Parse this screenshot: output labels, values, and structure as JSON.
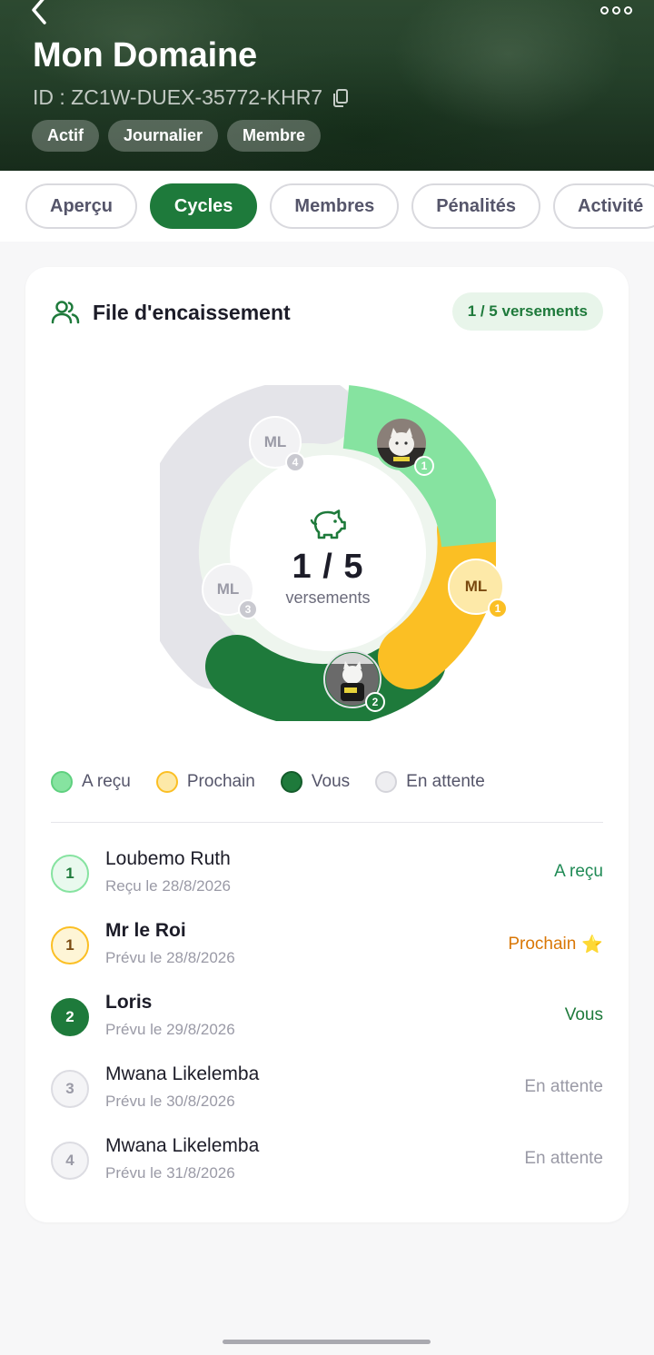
{
  "header": {
    "title": "Mon Domaine",
    "id_text": "ID : ZC1W-DUEX-35772-KHR7",
    "tags": [
      "Actif",
      "Journalier",
      "Membre"
    ],
    "icons": {
      "back": "chevron-left-icon",
      "more": "more-horizontal-icon",
      "copy": "copy-icon"
    }
  },
  "tabs": [
    {
      "label": "Aperçu",
      "active": false
    },
    {
      "label": "Cycles",
      "active": true
    },
    {
      "label": "Membres",
      "active": false
    },
    {
      "label": "Pénalités",
      "active": false
    },
    {
      "label": "Activité",
      "active": false
    }
  ],
  "queue": {
    "title": "File d'encaissement",
    "count_pill": "1 / 5 versements",
    "center": {
      "value": "1 / 5",
      "label": "versements",
      "icon": "piggy-bank-icon"
    },
    "donut_nodes": [
      {
        "initials": "",
        "badge": "1",
        "status": "received",
        "avatar": "cat-photo"
      },
      {
        "initials": "ML",
        "badge": "1",
        "status": "next"
      },
      {
        "initials": "",
        "badge": "2",
        "status": "you",
        "avatar": "cat-photo"
      },
      {
        "initials": "ML",
        "badge": "3",
        "status": "waiting"
      },
      {
        "initials": "ML",
        "badge": "4",
        "status": "waiting"
      }
    ],
    "legend": [
      {
        "label": "A reçu",
        "status": "received"
      },
      {
        "label": "Prochain",
        "status": "next"
      },
      {
        "label": "Vous",
        "status": "you"
      },
      {
        "label": "En attente",
        "status": "waiting"
      }
    ],
    "members": [
      {
        "rank": "1",
        "name": "Loubemo Ruth",
        "date": "Reçu le 28/8/2026",
        "status_label": "A reçu",
        "status": "received",
        "bold": false,
        "star": ""
      },
      {
        "rank": "1",
        "name": "Mr le Roi",
        "date": "Prévu le 28/8/2026",
        "status_label": "Prochain",
        "status": "next",
        "bold": true,
        "star": "⭐"
      },
      {
        "rank": "2",
        "name": "Loris",
        "date": "Prévu le 29/8/2026",
        "status_label": "Vous",
        "status": "you",
        "bold": true,
        "star": ""
      },
      {
        "rank": "3",
        "name": "Mwana Likelemba",
        "date": "Prévu le 30/8/2026",
        "status_label": "En attente",
        "status": "waiting",
        "bold": false,
        "star": ""
      },
      {
        "rank": "4",
        "name": "Mwana Likelemba",
        "date": "Prévu le 31/8/2026",
        "status_label": "En attente",
        "status": "waiting",
        "bold": false,
        "star": ""
      }
    ]
  },
  "colors": {
    "primary": "#1e7a3b",
    "received": "#86e3a0",
    "next": "#fbbf24",
    "you": "#1e7a3b",
    "waiting": "#e6e6ea"
  }
}
